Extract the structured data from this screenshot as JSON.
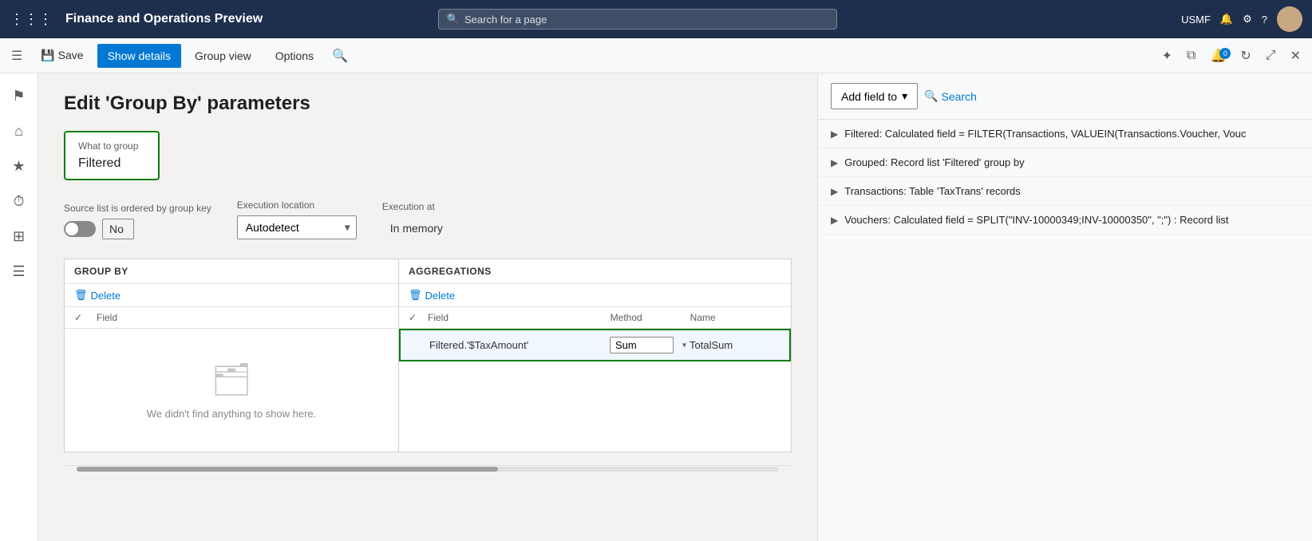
{
  "app": {
    "title": "Finance and Operations Preview",
    "search_placeholder": "Search for a page",
    "user": "USMF"
  },
  "toolbar": {
    "save_label": "Save",
    "show_details_label": "Show details",
    "group_view_label": "Group view",
    "options_label": "Options"
  },
  "page": {
    "title": "Edit 'Group By' parameters"
  },
  "what_to_group": {
    "label": "What to group",
    "value": "Filtered"
  },
  "source_list": {
    "label": "Source list is ordered by group key",
    "toggle_value": "No"
  },
  "execution_location": {
    "label": "Execution location",
    "value": "Autodetect"
  },
  "execution_at": {
    "label": "Execution at",
    "value": "In memory"
  },
  "group_by": {
    "header": "GROUP BY",
    "delete_label": "Delete",
    "field_col": "Field",
    "empty_text": "We didn't find anything to show here."
  },
  "aggregations": {
    "header": "AGGREGATIONS",
    "delete_label": "Delete",
    "field_col": "Field",
    "method_col": "Method",
    "name_col": "Name",
    "row": {
      "field": "Filtered.'$TaxAmount'",
      "method": "Sum",
      "name": "TotalSum"
    }
  },
  "right_panel": {
    "add_field_label": "Add field to",
    "search_label": "Search",
    "tree_items": [
      {
        "text": "Filtered: Calculated field = FILTER(Transactions, VALUEIN(Transactions.Voucher, Vouc"
      },
      {
        "text": "Grouped: Record list 'Filtered' group by"
      },
      {
        "text": "Transactions: Table 'TaxTrans' records"
      },
      {
        "text": "Vouchers: Calculated field = SPLIT(\"INV-10000349;INV-10000350\", \";\") : Record list"
      }
    ]
  },
  "sidebar": {
    "items": [
      {
        "icon": "≡",
        "name": "menu"
      },
      {
        "icon": "⌂",
        "name": "home"
      },
      {
        "icon": "★",
        "name": "favorites"
      },
      {
        "icon": "⏱",
        "name": "recent"
      },
      {
        "icon": "⊞",
        "name": "workspaces"
      },
      {
        "icon": "≡",
        "name": "list"
      }
    ]
  }
}
